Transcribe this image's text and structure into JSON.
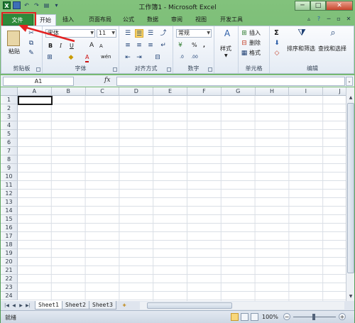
{
  "window": {
    "title": "工作簿1 - Microsoft Excel",
    "minimize": "─",
    "maximize": "□",
    "close": "✕"
  },
  "tabs": [
    "文件",
    "开始",
    "插入",
    "页面布局",
    "公式",
    "数据",
    "审阅",
    "视图",
    "开发工具"
  ],
  "ribbon": {
    "clipboard": {
      "label": "剪贴板",
      "paste": "粘贴"
    },
    "font": {
      "label": "字体",
      "font_name": "宋体",
      "font_size": "11",
      "bold": "B",
      "italic": "I",
      "underline": "U",
      "grow": "A",
      "shrink": "A",
      "font_color": "A",
      "phonetic": "wén"
    },
    "alignment": {
      "label": "对齐方式"
    },
    "number": {
      "label": "数字",
      "format": "常规",
      "percent": "%",
      "comma": ","
    },
    "styles": {
      "label": "样式",
      "styles_btn": "样式"
    },
    "cells": {
      "label": "单元格",
      "insert": "插入",
      "delete": "删除",
      "format": "格式"
    },
    "editing": {
      "label": "编辑",
      "sort_filter": "排序和筛选",
      "find_select": "查找和选择",
      "sum": "Σ"
    }
  },
  "formula_bar": {
    "name_box": "A1",
    "fx": "fx",
    "value": ""
  },
  "sheet": {
    "columns": [
      "A",
      "B",
      "C",
      "D",
      "E",
      "F",
      "G",
      "H",
      "I",
      "J"
    ],
    "rows": [
      "1",
      "2",
      "3",
      "4",
      "5",
      "6",
      "7",
      "8",
      "9",
      "10",
      "11",
      "12",
      "13",
      "14",
      "15",
      "16",
      "17",
      "18",
      "19",
      "20",
      "21",
      "22",
      "23",
      "24"
    ]
  },
  "sheet_tabs": [
    "Sheet1",
    "Sheet2",
    "Sheet3"
  ],
  "status": {
    "ready": "就绪",
    "zoom": "100%"
  },
  "colors": {
    "file_tab": "#2e8b3a",
    "highlight": "#e32222",
    "window": "#6fb06f"
  }
}
